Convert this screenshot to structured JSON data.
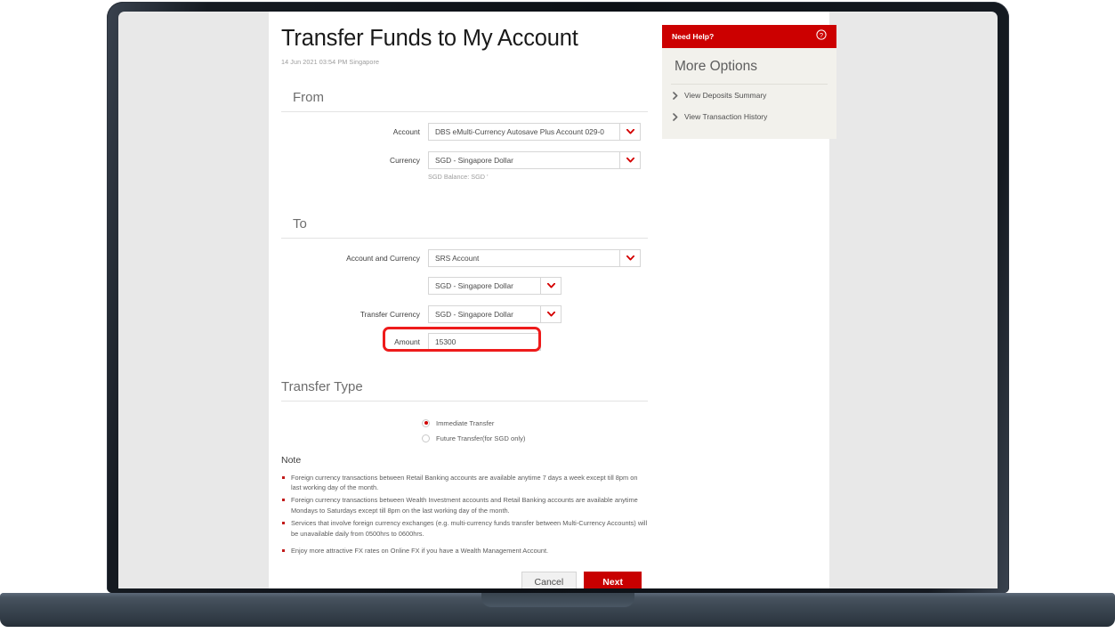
{
  "page": {
    "title": "Transfer Funds to My Account",
    "timestamp": "14 Jun 2021 03:54 PM Singapore"
  },
  "colors": {
    "brand_red": "#cc0000",
    "button_red": "#c80000",
    "annotation_red": "#ee1b1b",
    "sidebar_bg": "#f2f1ec"
  },
  "from_section": {
    "heading": "From",
    "account_label": "Account",
    "account_value": "DBS eMulti-Currency Autosave Plus Account 029-0",
    "currency_label": "Currency",
    "currency_value": "SGD - Singapore Dollar",
    "balance_hint": "SGD Balance: SGD '"
  },
  "to_section": {
    "heading": "To",
    "account_currency_label": "Account and Currency",
    "account_currency_value": "SRS Account",
    "account_currency_sub_value": "SGD - Singapore Dollar",
    "transfer_currency_label": "Transfer Currency",
    "transfer_currency_value": "SGD - Singapore Dollar",
    "amount_label": "Amount",
    "amount_value": "15300"
  },
  "transfer_type": {
    "heading": "Transfer Type",
    "options": [
      {
        "label": "Immediate Transfer",
        "selected": true
      },
      {
        "label": "Future Transfer(for SGD only)",
        "selected": false
      }
    ]
  },
  "note": {
    "heading": "Note",
    "items": [
      "Foreign currency transactions between Retail Banking accounts are available anytime 7 days a week except till 8pm on last working day of the month.",
      "Foreign currency transactions between Wealth Investment accounts and Retail Banking accounts are available anytime Mondays to Saturdays except till 8pm on the last working day of the month.",
      "Services that involve foreign currency exchanges (e.g. multi-currency funds transfer between Multi-Currency Accounts) will be unavailable daily from 0500hrs to 0600hrs.",
      "Enjoy more attractive FX rates on Online FX if you have a Wealth Management Account."
    ]
  },
  "actions": {
    "cancel_label": "Cancel",
    "next_label": "Next"
  },
  "sidebar": {
    "help_label": "Need Help?",
    "more_options_heading": "More Options",
    "links": [
      "View Deposits Summary",
      "View Transaction History"
    ]
  }
}
